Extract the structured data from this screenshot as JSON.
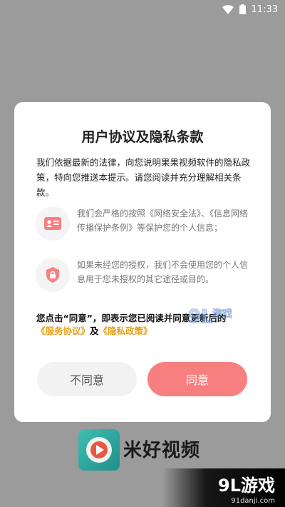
{
  "status_bar": {
    "time": "11:33"
  },
  "dialog": {
    "title": "用户协议及隐私条款",
    "intro": "我们依据最新的法律，向您说明果果视频软件的隐私政策，特向您推送本提示。请您阅读并充分理解相关条款。",
    "items": [
      {
        "icon": "id-card-icon",
        "text": "我们会严格的按照《网络安全法》、《信息网络传播保护条例》等保护您的个人信息；"
      },
      {
        "icon": "lock-icon",
        "text": "如果未经您的授权，我们不会使用您的个人信息用于您未授权的其它途径或目的。"
      }
    ],
    "notice": {
      "text": "您点击“同意”，即表示您已阅读并同意更新后的",
      "terms_link": "《服务协议》",
      "and": "及",
      "privacy_link": "《隐私政策》"
    },
    "buttons": {
      "disagree": "不同意",
      "agree": "同意"
    }
  },
  "app": {
    "name": "米好视频"
  },
  "watermark": {
    "logo": "9L游戏",
    "site": "91danji.com",
    "mid": "9L游戏"
  },
  "colors": {
    "agree": "#f77f80",
    "link": "#e6a01a",
    "overlay": "#9b9b9b"
  }
}
